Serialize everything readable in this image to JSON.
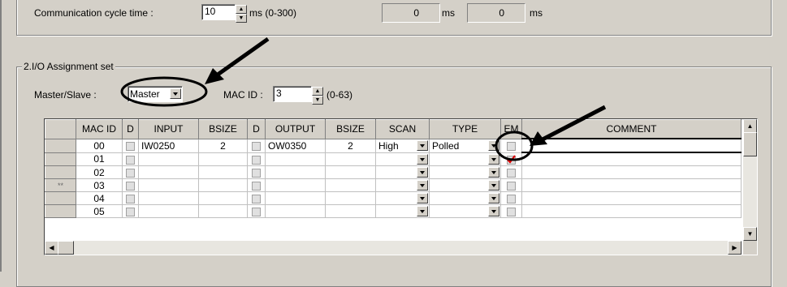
{
  "section1": {
    "comm_cycle_label": "Communication cycle time :",
    "comm_cycle_value": "10",
    "comm_cycle_range": "ms (0-300)",
    "readout1_value": "0",
    "readout1_unit": "ms",
    "readout2_value": "0",
    "readout2_unit": "ms"
  },
  "section2": {
    "title": "2.I/O Assignment set",
    "master_slave_label": "Master/Slave :",
    "master_slave_value": "Master",
    "mac_id_label": "MAC ID :",
    "mac_id_value": "3",
    "mac_id_range": "(0-63)"
  },
  "grid": {
    "headers": [
      "MAC ID",
      "D",
      "INPUT",
      "BSIZE",
      "D",
      "OUTPUT",
      "BSIZE",
      "SCAN",
      "TYPE",
      "EM",
      "COMMENT"
    ],
    "rows": [
      {
        "marker": "",
        "mac_id": "00",
        "input": "IW0250",
        "bsize_in": "2",
        "output": "OW0350",
        "bsize_out": "2",
        "scan": "High",
        "type": "Polled",
        "em_checked": false
      },
      {
        "marker": "",
        "mac_id": "01",
        "input": "",
        "bsize_in": "",
        "output": "",
        "bsize_out": "",
        "scan": "",
        "type": "",
        "em_checked": true
      },
      {
        "marker": "",
        "mac_id": "02",
        "input": "",
        "bsize_in": "",
        "output": "",
        "bsize_out": "",
        "scan": "",
        "type": "",
        "em_checked": false
      },
      {
        "marker": "**",
        "mac_id": "03",
        "input": "",
        "bsize_in": "",
        "output": "",
        "bsize_out": "",
        "scan": "",
        "type": "",
        "em_checked": false
      },
      {
        "marker": "",
        "mac_id": "04",
        "input": "",
        "bsize_in": "",
        "output": "",
        "bsize_out": "",
        "scan": "",
        "type": "",
        "em_checked": false
      },
      {
        "marker": "",
        "mac_id": "05",
        "input": "",
        "bsize_in": "",
        "output": "",
        "bsize_out": "",
        "scan": "",
        "type": "",
        "em_checked": false
      }
    ]
  },
  "colors": {
    "face": "#d4d0c8",
    "check_mark": "#e00000",
    "annotation": "#000000"
  }
}
